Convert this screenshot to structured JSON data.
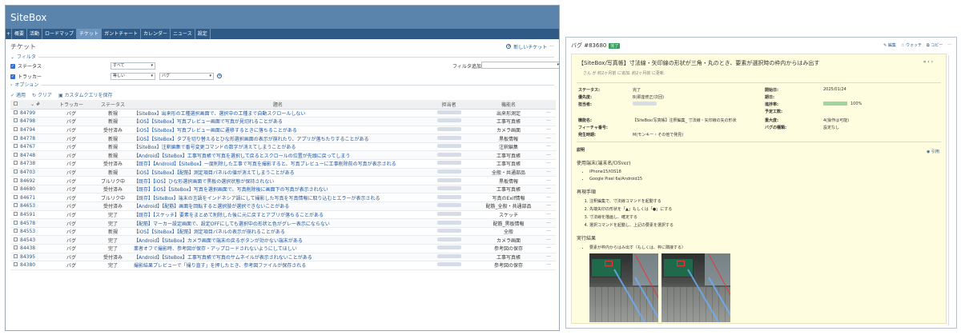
{
  "app": {
    "title": "SiteBox",
    "nav_plus": "+",
    "tabs": [
      {
        "label": "概要",
        "active": false
      },
      {
        "label": "活動",
        "active": false
      },
      {
        "label": "ロードマップ",
        "active": false
      },
      {
        "label": "チケット",
        "active": true
      },
      {
        "label": "ガントチャート",
        "active": false
      },
      {
        "label": "カレンダー",
        "active": false
      },
      {
        "label": "ニュース",
        "active": false
      },
      {
        "label": "設定",
        "active": false
      }
    ]
  },
  "page": {
    "title": "チケット",
    "new_ticket": "新しいチケット",
    "more": "···"
  },
  "filters": {
    "heading": "フィルタ",
    "status_label": "ステータス",
    "status_operator": "すべて",
    "tracker_label": "トラッカー",
    "tracker_operator": "等しい",
    "tracker_value": "バグ",
    "add_filter_label": "フィルタ追加",
    "add_filter_value": "",
    "options_heading": "オプション"
  },
  "actions": {
    "apply": "適用",
    "clear": "クリア",
    "save_query": "カスタムクエリを保存"
  },
  "table": {
    "headers": {
      "id": "#",
      "tracker": "トラッカー",
      "status": "ステータス",
      "subject": "題名",
      "assignee": "担当者",
      "function": "機能名"
    },
    "rows": [
      {
        "id": "84799",
        "tracker": "バグ",
        "status": "新規",
        "subject": "【SiteBox】出来形の工種選択画面で、選択中の工種まで自動スクロールしない",
        "function": "出来形測定"
      },
      {
        "id": "84798",
        "tracker": "バグ",
        "status": "新規",
        "subject": "【iOS】【SiteBox】写真プレビュー画面で写真が見切れることがある",
        "function": "工事写真帳"
      },
      {
        "id": "84794",
        "tracker": "バグ",
        "status": "受付済み",
        "subject": "【iOS】【SiteBox】写真プレビュー画面に遷移するときに落ちることがある",
        "function": "カメラ画面"
      },
      {
        "id": "84778",
        "tracker": "バグ",
        "status": "新規",
        "subject": "【iOS】【SiteBox】タブを切り替えるとひな形選択画面の表示が崩れたり、アプリが落ちたりすることがある",
        "function": "黒板情報"
      },
      {
        "id": "84767",
        "tracker": "バグ",
        "status": "新規",
        "subject": "【SiteBox】注釈編集で番号変更コマンドの数字が消えてしまうことがある",
        "function": "注釈編集"
      },
      {
        "id": "84748",
        "tracker": "バグ",
        "status": "新規",
        "subject": "【Android】【SiteBox】工事写真帳で写真を選択して戻るとスクロールの位置が先頭に戻ってしまう",
        "function": "工事写真帳"
      },
      {
        "id": "84738",
        "tracker": "バグ",
        "status": "受付済み",
        "subject": "【既存】【Android】【SiteBox】一度削除した工事で写真を撮影すると、写真プレビューに工事削除前の写真が表示される",
        "function": "工事写真帳"
      },
      {
        "id": "84703",
        "tracker": "バグ",
        "status": "新規",
        "subject": "【iOS】【SiteBox】【配筋】測定項目パネルの値が消えてしまうことがある",
        "function": "全般・共通部品"
      },
      {
        "id": "84692",
        "tracker": "バグ",
        "status": "ブルリク中",
        "subject": "【既存】【iOS】ひな形選択画面で黒板の選択状態が保持されない",
        "function": "黒板情報"
      },
      {
        "id": "84680",
        "tracker": "バグ",
        "status": "受付済み",
        "subject": "【既存】【iOS】【SiteBox】写真を選択画面で、写真削除後に画面下の写真が表示されない",
        "function": "工事写真帳"
      },
      {
        "id": "84671",
        "tracker": "バグ",
        "status": "ブルリク中",
        "subject": "【既存】【SiteBox】端末の言語をインドネシア語にして撮影した写真を写真情報に取り込むとエラーが表示される",
        "function": "写真のExif情報"
      },
      {
        "id": "84653",
        "tracker": "バグ",
        "status": "受付済み",
        "subject": "【Android】【配筋】画面を回転すると選択肢が選択できないことがある",
        "function": "配筋_全般・共通部品"
      },
      {
        "id": "84591",
        "tracker": "バグ",
        "status": "完了",
        "subject": "【既存】【スケッチ】要素をまとめて削除した後に元に戻すとアプリが落ちることがある",
        "function": "スケッチ"
      },
      {
        "id": "84578",
        "tracker": "バグ",
        "status": "完了",
        "subject": "【配筋】マーカー設定画面で、設定OFFにしても選択中の形状と色がグレー表示にならない",
        "function": "配筋_黒板情報"
      },
      {
        "id": "84553",
        "tracker": "バグ",
        "status": "新規",
        "subject": "【iOS】【SiteBox】【配筋】測定項目パネルの表示が崩れることがある",
        "function": "全般"
      },
      {
        "id": "84543",
        "tracker": "バグ",
        "status": "完了",
        "subject": "【Android】【SiteBox】カメラ画面で端末の戻るボタンが効かない端末がある",
        "function": "カメラ画面"
      },
      {
        "id": "84438",
        "tracker": "バグ",
        "status": "完了",
        "subject": "業者オフで撮影時、参考図が保存・アップロードされないようにしてほしい",
        "function": "参考図の保存"
      },
      {
        "id": "84395",
        "tracker": "バグ",
        "status": "受付済み",
        "subject": "【Android】【SiteBox】工事写真帳で写真のサムネイルが表示されないことがある",
        "function": "工事写真帳"
      },
      {
        "id": "84380",
        "tracker": "バグ",
        "status": "完了",
        "subject": "撮影結果プレビューで「撮り直す」を押したとき、参考図ファイルが保存される",
        "function": "参考図の保存"
      }
    ]
  },
  "detail": {
    "title": "バグ #83680",
    "badge": "完了",
    "tools": [
      "編集",
      "ウォッチ",
      "コピー",
      "···"
    ],
    "subject": "【SiteBox/写真帳】寸法線・矢印線の形状が三角・丸のとき、要素が選択時の枠内からはみ出す",
    "author": "さん が 約2ヶ月前 に追加. 約2ヶ月前 に更新.",
    "attributes": {
      "status_l": "ステータス:",
      "status_v": "完了",
      "priority_l": "優先度:",
      "priority_v": "B(即座修正/次回)",
      "assignee_l": "担当者:",
      "start_l": "開始日:",
      "start_v": "2025/01/24",
      "due_l": "期日:",
      "progress_l": "進捗率:",
      "progress_v": "100%",
      "progress_fraction": 1.0,
      "estimate_l": "予定工数:",
      "function_l": "機能名:",
      "function_v": "【SiteBox/写真帳】注釈編集_ 寸法線・矢印線の矢の形状",
      "severity_l": "重大度:",
      "severity_v": "4(操作は可能)",
      "feature_no_l": "フィーチャ番号:",
      "bugtype_l": "バグの種類:",
      "bugtype_v": "設定なし",
      "occurrence_l": "発生時期:",
      "occurrence_v": "M(モンキー・その他で発見)"
    },
    "description_heading": "説明",
    "quote": "引用",
    "env_heading": "使用端末(端末名/OSver)",
    "env_items": [
      "iPhone15/iOS18",
      "Google Pixel 6a/Android15"
    ],
    "steps_heading": "再現手順",
    "steps": [
      "注釈編集で、寸法線コマンドを起動する",
      "先端矢印の形状を「▲」もしくは「●」にする",
      "寸法線を描画し、確定する",
      "選択コマンドを起動し、上記の要素を選択する"
    ],
    "result_heading": "実行結果",
    "result_items": [
      "要素が枠内からはみ出す（もしくは、枠に隣接する）"
    ]
  },
  "colors": {
    "topbar": "#5b84ad",
    "navbar": "#2f5a86",
    "link": "#1e55a0",
    "detail_bg": "#fffde0",
    "badge": "#3a9a5a"
  }
}
